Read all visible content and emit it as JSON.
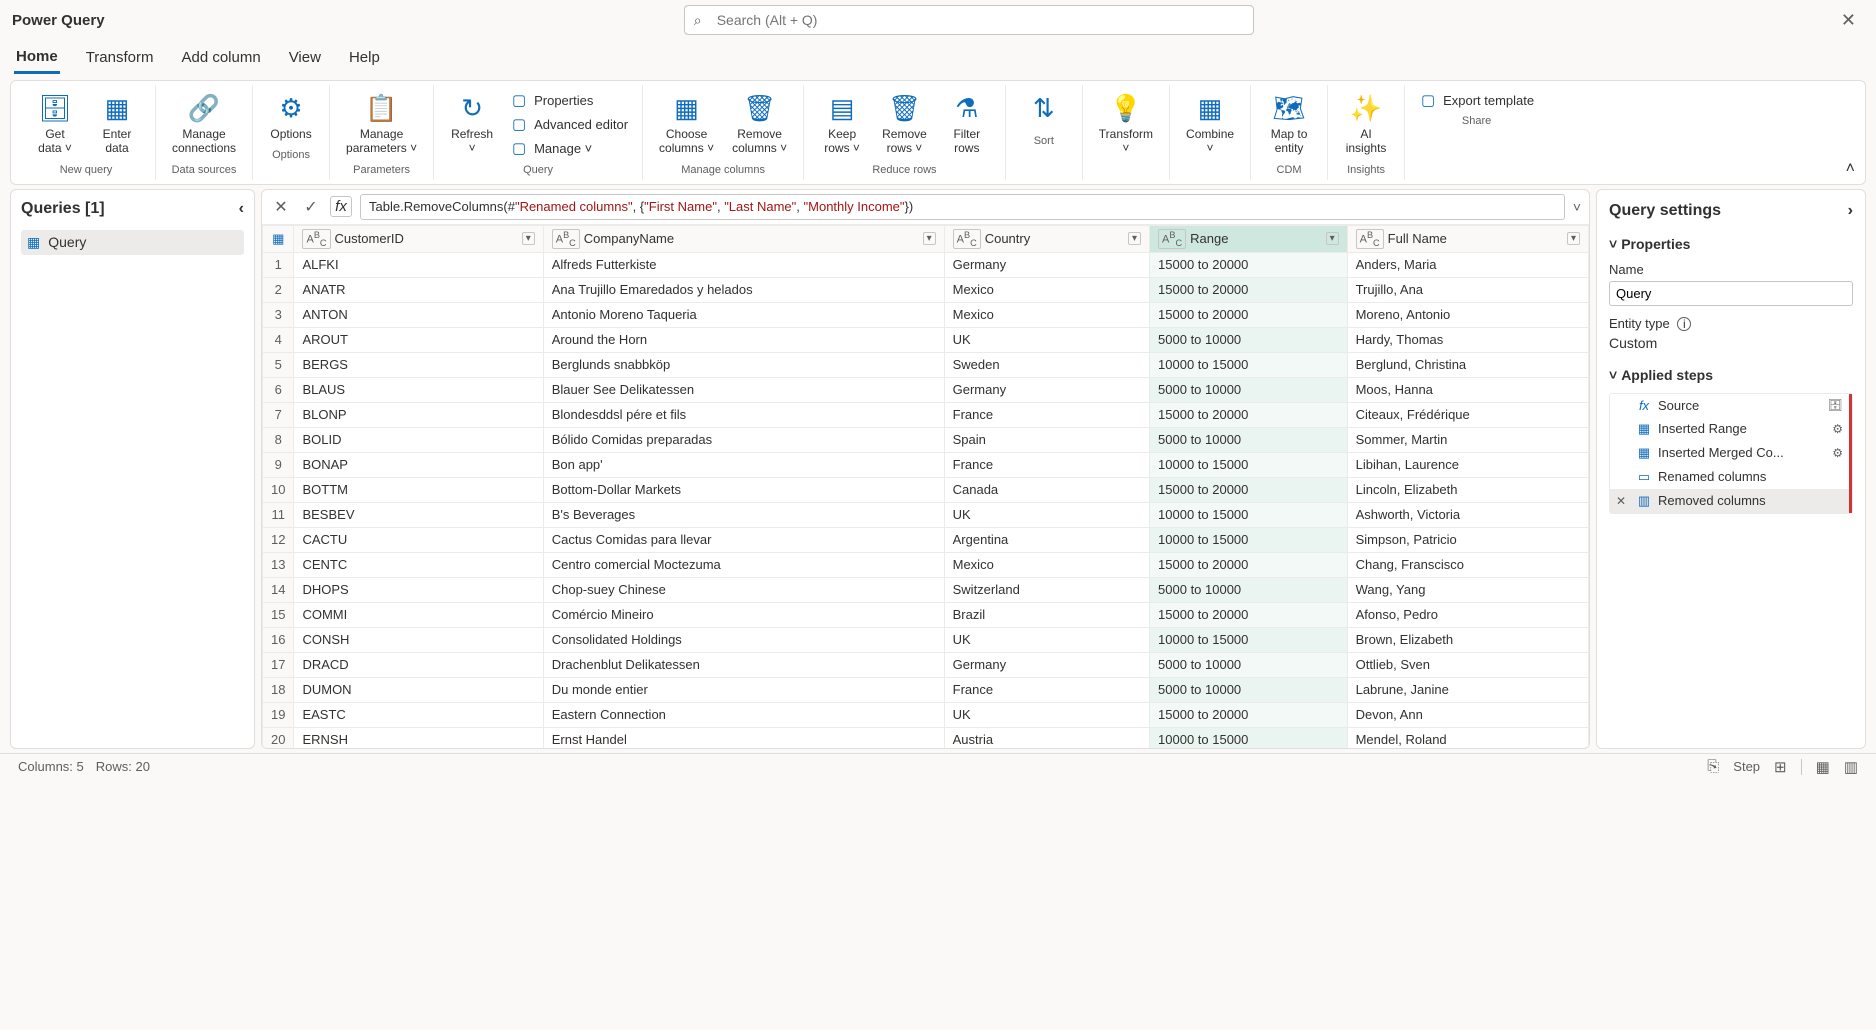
{
  "titlebar": {
    "title": "Power Query",
    "search_placeholder": "Search (Alt + Q)"
  },
  "menubar": {
    "items": [
      "Home",
      "Transform",
      "Add column",
      "View",
      "Help"
    ],
    "active": "Home"
  },
  "ribbon": {
    "groups": [
      {
        "label": "New query",
        "buttons": [
          {
            "label": "Get\ndata ˅"
          },
          {
            "label": "Enter\ndata"
          }
        ]
      },
      {
        "label": "Data sources",
        "buttons": [
          {
            "label": "Manage\nconnections"
          }
        ]
      },
      {
        "label": "Options",
        "buttons": [
          {
            "label": "Options"
          }
        ]
      },
      {
        "label": "Parameters",
        "buttons": [
          {
            "label": "Manage\nparameters ˅"
          }
        ]
      },
      {
        "label": "Query",
        "buttons": [
          {
            "label": "Refresh\n˅"
          }
        ],
        "side": [
          "Properties",
          "Advanced editor",
          "Manage ˅"
        ]
      },
      {
        "label": "Manage columns",
        "buttons": [
          {
            "label": "Choose\ncolumns ˅"
          },
          {
            "label": "Remove\ncolumns ˅"
          }
        ]
      },
      {
        "label": "Reduce rows",
        "buttons": [
          {
            "label": "Keep\nrows ˅"
          },
          {
            "label": "Remove\nrows ˅"
          },
          {
            "label": "Filter\nrows"
          }
        ]
      },
      {
        "label": "Sort",
        "buttons": [
          {
            "label": ""
          }
        ]
      },
      {
        "label": "",
        "buttons": [
          {
            "label": "Transform\n˅"
          }
        ]
      },
      {
        "label": "",
        "buttons": [
          {
            "label": "Combine\n˅"
          }
        ]
      },
      {
        "label": "CDM",
        "buttons": [
          {
            "label": "Map to\nentity"
          }
        ]
      },
      {
        "label": "Insights",
        "buttons": [
          {
            "label": "AI\ninsights"
          }
        ]
      },
      {
        "label": "Share",
        "side": [
          "Export template"
        ]
      }
    ]
  },
  "queries": {
    "header": "Queries [1]",
    "items": [
      "Query"
    ]
  },
  "formula": {
    "prefix": "Table.RemoveColumns(#",
    "arg1": "\"Renamed columns\"",
    "mid": ", {",
    "s1": "\"First Name\"",
    "s2": "\"Last Name\"",
    "s3": "\"Monthly Income\"",
    "suffix": "})"
  },
  "table": {
    "columns": [
      "CustomerID",
      "CompanyName",
      "Country",
      "Range",
      "Full Name"
    ],
    "selected_col": "Range",
    "rows": [
      [
        "ALFKI",
        "Alfreds Futterkiste",
        "Germany",
        "15000 to 20000",
        "Anders, Maria"
      ],
      [
        "ANATR",
        "Ana Trujillo Emaredados y helados",
        "Mexico",
        "15000 to 20000",
        "Trujillo, Ana"
      ],
      [
        "ANTON",
        "Antonio Moreno Taqueria",
        "Mexico",
        "15000 to 20000",
        "Moreno, Antonio"
      ],
      [
        "AROUT",
        "Around the Horn",
        "UK",
        "5000 to 10000",
        "Hardy, Thomas"
      ],
      [
        "BERGS",
        "Berglunds snabbköp",
        "Sweden",
        "10000 to 15000",
        "Berglund, Christina"
      ],
      [
        "BLAUS",
        "Blauer See Delikatessen",
        "Germany",
        "5000 to 10000",
        "Moos, Hanna"
      ],
      [
        "BLONP",
        "Blondesddsl pére et fils",
        "France",
        "15000 to 20000",
        "Citeaux, Frédérique"
      ],
      [
        "BOLID",
        "Bólido Comidas preparadas",
        "Spain",
        "5000 to 10000",
        "Sommer, Martin"
      ],
      [
        "BONAP",
        "Bon app'",
        "France",
        "10000 to 15000",
        "Libihan, Laurence"
      ],
      [
        "BOTTM",
        "Bottom-Dollar Markets",
        "Canada",
        "15000 to 20000",
        "Lincoln, Elizabeth"
      ],
      [
        "BESBEV",
        "B's Beverages",
        "UK",
        "10000 to 15000",
        "Ashworth, Victoria"
      ],
      [
        "CACTU",
        "Cactus Comidas para llevar",
        "Argentina",
        "10000 to 15000",
        "Simpson, Patricio"
      ],
      [
        "CENTC",
        "Centro comercial Moctezuma",
        "Mexico",
        "15000 to 20000",
        "Chang, Franscisco"
      ],
      [
        "DHOPS",
        "Chop-suey Chinese",
        "Switzerland",
        "5000 to 10000",
        "Wang, Yang"
      ],
      [
        "COMMI",
        "Comércio Mineiro",
        "Brazil",
        "15000 to 20000",
        "Afonso, Pedro"
      ],
      [
        "CONSH",
        "Consolidated Holdings",
        "UK",
        "10000 to 15000",
        "Brown, Elizabeth"
      ],
      [
        "DRACD",
        "Drachenblut Delikatessen",
        "Germany",
        "5000 to 10000",
        "Ottlieb, Sven"
      ],
      [
        "DUMON",
        "Du monde entier",
        "France",
        "5000 to 10000",
        "Labrune, Janine"
      ],
      [
        "EASTC",
        "Eastern Connection",
        "UK",
        "15000 to 20000",
        "Devon, Ann"
      ],
      [
        "ERNSH",
        "Ernst Handel",
        "Austria",
        "10000 to 15000",
        "Mendel, Roland"
      ]
    ]
  },
  "settings": {
    "header": "Query settings",
    "properties_label": "Properties",
    "name_label": "Name",
    "name_value": "Query",
    "entity_label": "Entity type",
    "entity_value": "Custom",
    "steps_label": "Applied steps",
    "steps": [
      {
        "name": "Source",
        "icon": "fx",
        "gear": false,
        "db": true
      },
      {
        "name": "Inserted Range",
        "icon": "▦",
        "gear": true,
        "db": true
      },
      {
        "name": "Inserted Merged Co...",
        "icon": "▦",
        "gear": true
      },
      {
        "name": "Renamed columns",
        "icon": "▭"
      },
      {
        "name": "Removed columns",
        "icon": "▥",
        "selected": true,
        "x": true
      }
    ]
  },
  "statusbar": {
    "cols": "Columns: 5",
    "rows": "Rows: 20",
    "step": "Step"
  }
}
